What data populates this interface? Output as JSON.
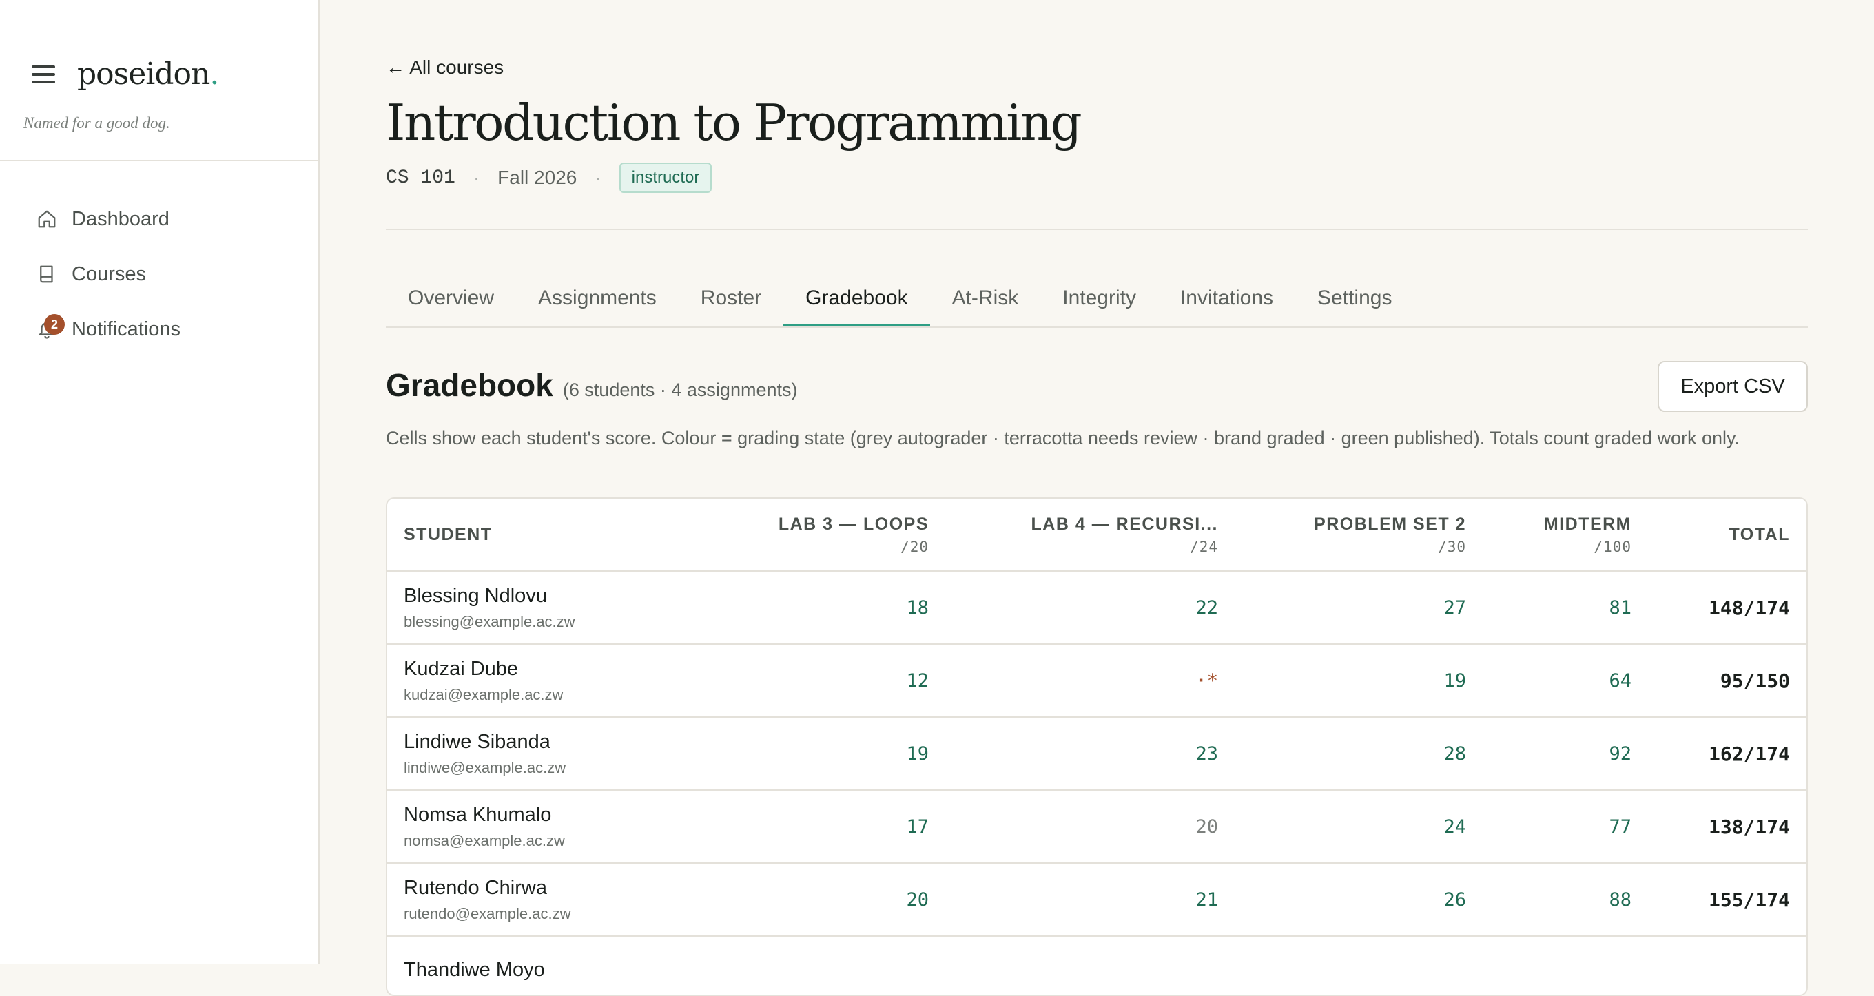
{
  "app": {
    "logo": "poseidon",
    "logo_dot": ".",
    "tagline": "Named for a good dog."
  },
  "sidebar": {
    "items": [
      {
        "label": "Dashboard",
        "icon": "home-icon"
      },
      {
        "label": "Courses",
        "icon": "book-icon"
      },
      {
        "label": "Notifications",
        "icon": "bell-icon",
        "badge": "2"
      }
    ]
  },
  "header": {
    "back_link": "← All courses",
    "title": "Introduction to Programming",
    "course_code": "CS 101",
    "separator": "·",
    "term": "Fall 2026",
    "role": "instructor"
  },
  "tabs": [
    "Overview",
    "Assignments",
    "Roster",
    "Gradebook",
    "At-Risk",
    "Integrity",
    "Invitations",
    "Settings"
  ],
  "active_tab": "Gradebook",
  "gradebook": {
    "title": "Gradebook",
    "counts": "(6 students · 4 assignments)",
    "export_label": "Export CSV",
    "description": "Cells show each student's score. Colour = grading state (grey autograder · terracotta needs review · brand graded · green published). Totals count graded work only.",
    "columns": {
      "student": "STUDENT",
      "assignments": [
        {
          "title": "LAB 3 — LOOPS",
          "max": "/20"
        },
        {
          "title": "LAB 4 — RECURSI...",
          "max": "/24"
        },
        {
          "title": "PROBLEM SET 2",
          "max": "/30"
        },
        {
          "title": "MIDTERM",
          "max": "/100"
        }
      ],
      "total": "TOTAL"
    },
    "rows": [
      {
        "name": "Blessing Ndlovu",
        "email": "blessing@example.ac.zw",
        "scores": [
          "18",
          "22",
          "27",
          "81"
        ],
        "total": "148/174"
      },
      {
        "name": "Kudzai Dube",
        "email": "kudzai@example.ac.zw",
        "scores": [
          "12",
          "·*",
          "19",
          "64"
        ],
        "total": "95/150"
      },
      {
        "name": "Lindiwe Sibanda",
        "email": "lindiwe@example.ac.zw",
        "scores": [
          "19",
          "23",
          "28",
          "92"
        ],
        "total": "162/174"
      },
      {
        "name": "Nomsa Khumalo",
        "email": "nomsa@example.ac.zw",
        "scores": [
          "17",
          "20",
          "24",
          "77"
        ],
        "total": "138/174"
      },
      {
        "name": "Rutendo Chirwa",
        "email": "rutendo@example.ac.zw",
        "scores": [
          "20",
          "21",
          "26",
          "88"
        ],
        "total": "155/174"
      },
      {
        "name": "Thandiwe Moyo",
        "email": "",
        "scores": [
          "",
          "",
          "",
          ""
        ],
        "total": ""
      }
    ]
  },
  "colors": {
    "brand": "#2f9e84",
    "graded": "#1f6b53",
    "autograder": "#7c807d",
    "needs_review": "#a4502c",
    "badge": "#a4502c"
  }
}
